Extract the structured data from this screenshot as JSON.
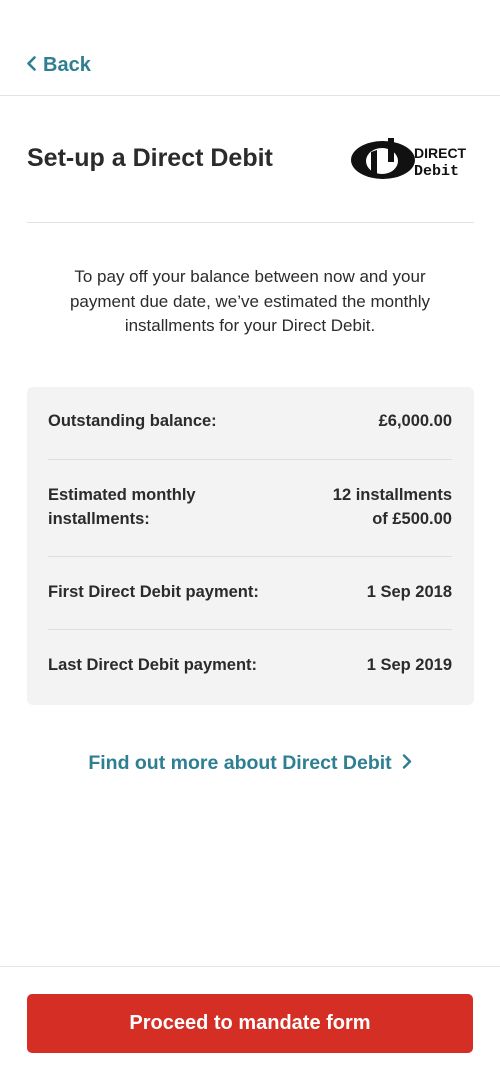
{
  "nav": {
    "back_label": "Back"
  },
  "header": {
    "title": "Set-up a Direct Debit",
    "logo_text_top": "DIRECT",
    "logo_text_bottom": "Debit"
  },
  "intro": "To pay off your balance between now and your payment due date, we’ve estimated the monthly installments for your Direct Debit.",
  "summary": {
    "outstanding": {
      "label": "Outstanding balance:",
      "value": "£6,000.00"
    },
    "monthly": {
      "label_line1": "Estimated monthly",
      "label_line2": "installments:",
      "value_line1": "12 installments",
      "value_line2": "of £500.00"
    },
    "first": {
      "label": "First Direct Debit payment:",
      "value": "1 Sep 2018"
    },
    "last": {
      "label": "Last Direct Debit payment:",
      "value": "1 Sep 2019"
    }
  },
  "link": {
    "label": "Find out more about Direct Debit"
  },
  "footer": {
    "proceed_label": "Proceed to mandate form"
  },
  "colors": {
    "accent": "#2f7f92",
    "primary": "#d42e25",
    "card_bg": "#f3f3f3"
  }
}
